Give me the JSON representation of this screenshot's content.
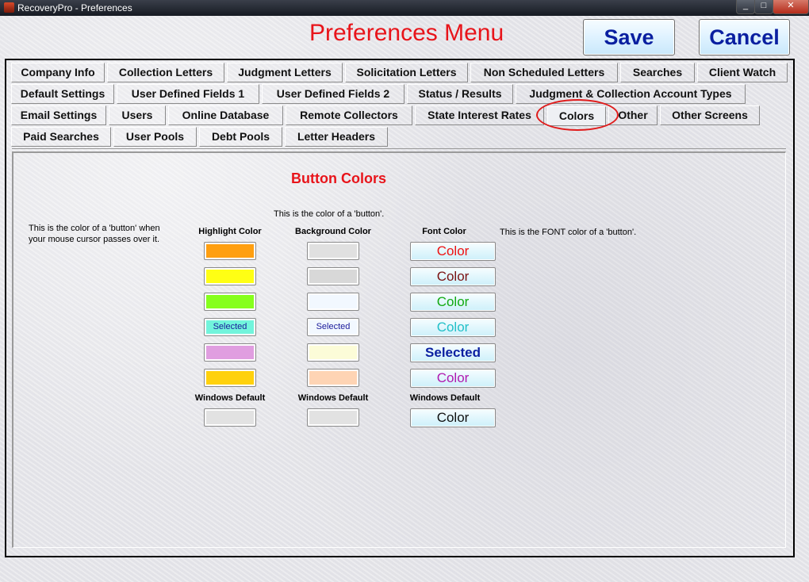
{
  "window": {
    "title": "RecoveryPro - Preferences",
    "min": "_",
    "max": "□",
    "close": "✕"
  },
  "header": {
    "menu_title": "Preferences Menu",
    "save_label": "Save",
    "cancel_label": "Cancel"
  },
  "tabs": {
    "row1": [
      "Company Info",
      "Collection Letters",
      "Judgment Letters",
      "Solicitation Letters",
      "Non Scheduled Letters",
      "Searches",
      "Client Watch"
    ],
    "row2": [
      "Default Settings",
      "User Defined Fields 1",
      "User Defined Fields 2",
      "Status / Results",
      "Judgment & Collection Account Types"
    ],
    "row3": [
      "Email Settings",
      "Users",
      "Online Database",
      "Remote Collectors",
      "State Interest Rates",
      "Colors",
      "Other",
      "Other Screens"
    ],
    "row4": [
      "Paid Searches",
      "User Pools",
      "Debt Pools",
      "Letter Headers"
    ],
    "active": "Colors"
  },
  "colors_panel": {
    "section_title": "Button Colors",
    "highlight_note_line1": "This is the color of a 'button' when",
    "highlight_note_line2": "your mouse cursor passes over it.",
    "background_note": "This is the color of  a 'button'.",
    "font_note": "This is the FONT color of  a 'button'.",
    "highlight_header": "Highlight Color",
    "background_header": "Background Color",
    "font_header": "Font Color",
    "windows_default": "Windows Default",
    "highlight_swatches": [
      {
        "color": "#ff9f10",
        "label": ""
      },
      {
        "color": "#ffff14",
        "label": ""
      },
      {
        "color": "#86ff1c",
        "label": ""
      },
      {
        "color": "#72f4dc",
        "label": "Selected"
      },
      {
        "color": "#e09ee0",
        "label": ""
      },
      {
        "color": "#ffd10c",
        "label": ""
      }
    ],
    "background_swatches": [
      {
        "color": "#e0e0e0",
        "label": ""
      },
      {
        "color": "#d8d8d8",
        "label": ""
      },
      {
        "color": "#f2f8ff",
        "label": ""
      },
      {
        "color": "#f2f8ff",
        "label": "Selected"
      },
      {
        "color": "#fcfcd8",
        "label": ""
      },
      {
        "color": "#fed4b4",
        "label": ""
      }
    ],
    "font_buttons": [
      {
        "label": "Color",
        "color": "#ee1111"
      },
      {
        "label": "Color",
        "color": "#7a1212"
      },
      {
        "label": "Color",
        "color": "#11aa11"
      },
      {
        "label": "Color",
        "color": "#22c0c8"
      },
      {
        "label": "Selected",
        "color": "#0a1fa0"
      },
      {
        "label": "Color",
        "color": "#b01ab0"
      }
    ],
    "default_highlight_color": "#e2e2e2",
    "default_background_color": "#e2e2e2",
    "default_font_label": "Color",
    "default_font_color": "#111111"
  }
}
